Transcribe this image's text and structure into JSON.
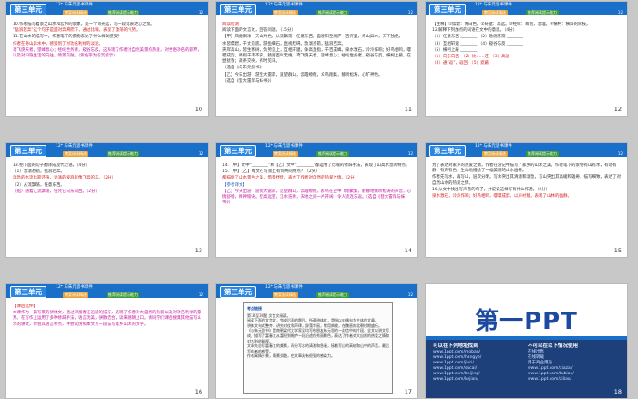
{
  "common": {
    "unit": "第三单元",
    "head": "12* 与朱元思书课件",
    "pill1": "教案阅读精选",
    "pill2": "推荐阅读提示能力",
    "pg": "12"
  },
  "slides": [
    {
      "num": "10",
      "lines": [
        {
          "c": "",
          "t": "10.作者描写着景之山水和宏伟的景象，是一个目光远，写一段话表达心之情。"
        },
        {
          "c": "red",
          "t": "“猛浪若奔”这个句子是面对奔腾而下，通过比喻，表现了激荡的气势。"
        },
        {
          "c": "",
          "t": "11.在山水的描写中，作者笔下的景物表达了什么样的感受？"
        },
        {
          "c": "red",
          "t": "作者在奇山异水中，感受到了对功名利禄的淡泊。"
        },
        {
          "c": "",
          "t": ""
        },
        {
          "c": "mag",
          "t": "鸢飞戾天者，望峰息心；经纶世务者，窥谷忘反。这表现了作者对自然美景的热爱，对世俗功名的鄙弃，以及对归隐生活的向往，情景交融。（紫色字为答案提示）"
        }
      ]
    },
    {
      "num": "11",
      "lines": [
        {
          "c": "red",
          "t": "阅读检测"
        },
        {
          "c": "",
          "t": "阅读下面的文言文，回答问题。（15分）"
        },
        {
          "c": "",
          "t": "【甲】风烟俱净，天山共色。从流飘荡，任意东西。自富阳至桐庐一百许里，奇山异水，天下独绝。"
        },
        {
          "c": "",
          "t": "水皆缥碧，千丈见底。游鱼细石，直视无碍。急湍甚箭，猛浪若奔。"
        },
        {
          "c": "",
          "t": "夹岸高山，皆生寒树，负势竞上，互相轩邈，争高直指，千百成峰。泉水激石，泠泠作响；好鸟相鸣，嘤嘤成韵。蝉则千转不穷，猿则百叫无绝。鸢飞戾天者，望峰息心；经纶世务者，窥谷忘反。横柯上蔽，在昼犹昏；疏条交映，有时见日。"
        },
        {
          "c": "",
          "t": "（选自《与朱元思书》）"
        },
        {
          "c": "",
          "t": "【乙】今日出游，游至大雷岸，遥望群山，云霞缭绕，众鸟翔集，静听松涛，心旷神怡。"
        },
        {
          "c": "",
          "t": "（选自《登大雷岸与妹书》）"
        }
      ]
    },
    {
      "num": "12",
      "lines": [
        {
          "c": "",
          "t": "【注释】①缥碧：青白色。②轩邈：高远。③经纶：筹划，治理。④横柯：横斜的树枝。"
        },
        {
          "c": "",
          "t": "12.解释下列加点的词语在文中的意思。（4分）"
        },
        {
          "c": "",
          "t": "（1）任意东西 ________  （2）急湍甚箭 ________"
        },
        {
          "c": "",
          "t": "（3）互相轩邈 ________  （4）窥谷忘反 ________"
        },
        {
          "c": "",
          "t": "（5）横柯上蔽 ________"
        },
        {
          "c": "red",
          "t": "（1）向东向西　（2）比……还　（3）高远"
        },
        {
          "c": "red",
          "t": "（4）通“返”，返回　（5）遮蔽"
        }
      ]
    },
    {
      "num": "13",
      "lines": [
        {
          "c": "",
          "t": "13.把下面的句子翻译成现代汉语。（4分）"
        },
        {
          "c": "",
          "t": "（1）急湍甚箭，猛浪若奔。"
        },
        {
          "c": "red",
          "t": "湍急的水流比箭还快，汹涌的波浪就像飞奔的马。（2分）"
        },
        {
          "c": "",
          "t": ""
        },
        {
          "c": "",
          "t": "（2）从流飘荡，任意东西。"
        },
        {
          "c": "mag",
          "t": "（船）随着江流飘荡，任凭它向东向西。（2分）"
        }
      ]
    },
    {
      "num": "14",
      "lines": [
        {
          "c": "",
          "t": "14.【甲】文中“________”和【乙】文中“________”都运用了比喻的修辞手法，表现了山高水急的特点。"
        },
        {
          "c": "",
          "t": "15.【甲】【乙】两文在写景上有何共同特点？（2分）"
        },
        {
          "c": "red",
          "t": "都描绘了山水景色之美，借景抒情，表达了作者对自然的热爱之情。（2分）"
        },
        {
          "c": "blu",
          "t": "【参考译文】"
        },
        {
          "c": "mag",
          "t": "【乙】今天出游，游到大雷岸，远望群山，云霞缭绕，群鸟在空中飞翔聚集，静静地倾听松涛的声音，心情舒畅，精神愉快。登高远望，江水浩渺，天地之间一片开阔，令人流连忘返。（选自《登大雷岸与妹书》）"
        }
      ]
    },
    {
      "num": "15",
      "lines": [
        {
          "c": "",
          "t": "为了表达对家乡的热爱之情，作者在游记中描写了家乡的山水之美。作者笔下的景物有山有水，有动有静，有声有色，生动地描绘了一幅美丽的山水画卷。"
        },
        {
          "c": "",
          "t": "作者先写水，再写山，层次分明。写水突出其清澈和湍急，写山突出其高峻和雄奇，描写细致，表达了对自然山水的热爱之情。"
        },
        {
          "c": "",
          "t": "16.从文中找出写声音的句子，并说说这样写有什么作用。（2分）"
        },
        {
          "c": "red",
          "t": "泉水激石，泠泠作响；好鸟相鸣，嘤嘤成韵。以声衬静，表现了山林的幽静。"
        }
      ]
    },
    {
      "num": "16",
      "lines": [
        {
          "c": "red",
          "t": "【课后延伸】"
        },
        {
          "c": "mag",
          "t": "本课作为一篇写景的骈体文，通过对富春江沿途的描写，表现了作者对大自然的热爱以及对功名利禄的鄙弃。在写作上运用了多种修辞手法，语言优美，骈散结合，读来朗朗上口。请同学们课后搜集其他描写山水的骈文，体会其语言特点，并尝试仿照本文写一段描写家乡山水的文字。"
        }
      ]
    },
    {
      "num": "17",
      "box": {
        "title": "考点链接",
        "lines": [
          "第18至30题 文言文阅读。",
          "阅读下面的文言文，完成后面的题目。所谓骈体文，是指以对偶句为主体的文章。",
          "骈体文句式整齐，讲究对仗和声律，辞藻华丽，常用典故，在魏晋南北朝时期盛行。",
          "《与朱元思书》是南朝梁代文学家吴均写给朋友朱元思的一封信中的片段，全文以骈文写成，描写了富春江从富阳到桐庐一段沿途的秀丽景色，表达了作者对大自然的热爱之情和对名利的鄙视。",
          "文章先总写富春江的美景，再分写水的清澈和急湍，接着写山的高峻和山中的声音，最后写作者的感受。",
          "作者寓情于景，情景交融，使文章具有很强的感染力。"
        ]
      }
    }
  ],
  "logo": {
    "brand": "第一PPT",
    "col1_title": "可以在下列地址找到",
    "col1": [
      "www.1ppt.com/moban/",
      "www.1ppt.com/hangye/",
      "www.1ppt.com/jieri/",
      "www.1ppt.com/sucai/",
      "www.1ppt.com/beijing/",
      "www.1ppt.com/kejian/"
    ],
    "col2_title": "不可以在以下情况使用",
    "col2": [
      "在线出售",
      "在线转载",
      "用于商业用途",
      "www.1ppt.com/xiazai/",
      "www.1ppt.com/tubiao/",
      "www.1ppt.com/ziliao/"
    ],
    "num": "18"
  }
}
